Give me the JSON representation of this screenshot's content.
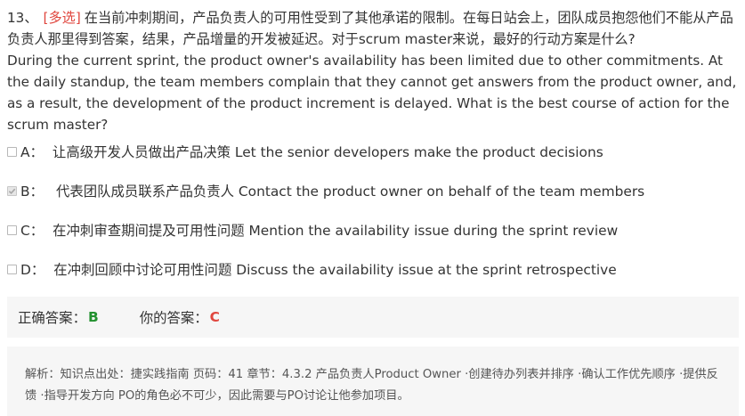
{
  "question": {
    "number": "13、",
    "type_tag": "[多选]",
    "text_cn": "在当前冲刺期间，产品负责人的可用性受到了其他承诺的限制。在每日站会上，团队成员抱怨他们不能从产品负责人那里得到答案，结果，产品增量的开发被延迟。对于scrum master来说，最好的行动方案是什么?",
    "text_en": "During the current sprint, the product owner's availability has been limited due to other commitments. At the daily standup, the team members complain that they cannot get answers from the product owner, and, as a result, the development of the product increment is delayed. What is the best course of action for the scrum master?"
  },
  "options": [
    {
      "letter": "A：",
      "text": "让高级开发人员做出产品决策 Let the senior developers make the product decisions",
      "checked": false
    },
    {
      "letter": "B：",
      "text": "代表团队成员联系产品负责人 Contact the product owner on behalf of the team members",
      "checked": true
    },
    {
      "letter": "C：",
      "text": "在冲刺审查期间提及可用性问题 Mention the availability issue during the sprint review",
      "checked": false
    },
    {
      "letter": "D：",
      "text": "在冲刺回顾中讨论可用性问题 Discuss the availability issue at the sprint retrospective",
      "checked": false
    }
  ],
  "answer": {
    "correct_label": "正确答案：",
    "correct_value": "B",
    "yours_label": "你的答案：",
    "yours_value": "C"
  },
  "explanation": {
    "text": "解析：知识点出处：捷实践指南 页码：41 章节：4.3.2 产品负责人Product Owner ·创建待办列表并排序 ·确认工作优先顺序 ·提供反馈 ·指导开发方向 PO的角色必不可少，因此需要与PO讨论让他参加项目。"
  },
  "colors": {
    "tag": "#e0463e",
    "correct": "#23912f",
    "wrong": "#e0463e",
    "panel_bg": "#f6f6f6"
  }
}
